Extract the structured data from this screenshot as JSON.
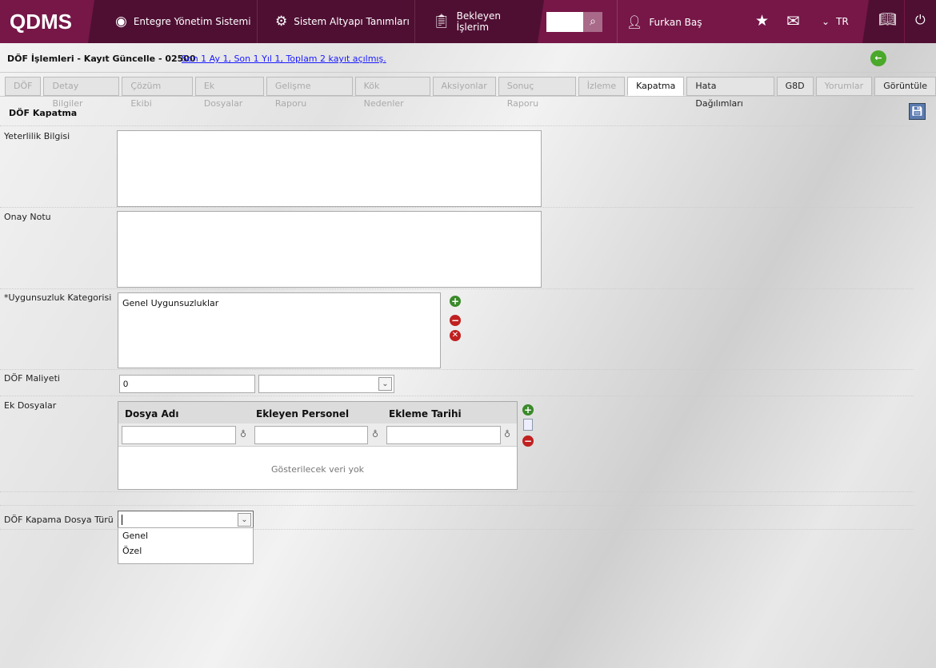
{
  "header": {
    "logo": "QDMS",
    "nav": [
      {
        "label": "Entegre Yönetim Sistemi",
        "icon": "q-icon"
      },
      {
        "label": "Sistem Altyapı Tanımları",
        "icon": "gear-icon"
      },
      {
        "label": "Bekleyen İşlerim",
        "icon": "clipboard-icon"
      }
    ],
    "user": "Furkan Baş",
    "lang": "TR"
  },
  "subheader": {
    "title": "DÖF İşlemleri - Kayıt Güncelle - 02500",
    "stats": "Son 1 Ay 1, Son 1 Yıl 1, Toplam 2 kayıt açılmış."
  },
  "tabs": [
    {
      "label": "DÖF"
    },
    {
      "label": "Detay Bilgiler"
    },
    {
      "label": "Çözüm Ekibi"
    },
    {
      "label": "Ek Dosyalar"
    },
    {
      "label": "Gelişme Raporu"
    },
    {
      "label": "Kök Nedenler"
    },
    {
      "label": "Aksiyonlar"
    },
    {
      "label": "Sonuç Raporu"
    },
    {
      "label": "İzleme"
    },
    {
      "label": "Kapatma"
    },
    {
      "label": "Hata Dağılımları"
    },
    {
      "label": "G8D"
    },
    {
      "label": "Yorumlar"
    },
    {
      "label": "Görüntüle"
    }
  ],
  "panel": {
    "title": "DÖF Kapatma",
    "yeterlilik_label": "Yeterlilik Bilgisi",
    "onay_label": "Onay Notu",
    "kategori_label": "*Uygunsuzluk Kategorisi",
    "kategori_value": "Genel Uygunsuzluklar",
    "maliyet_label": "DÖF Maliyeti",
    "maliyet_value": "0",
    "ek_label": "Ek Dosyalar",
    "columns": [
      "Dosya Adı",
      "Ekleyen Personel",
      "Ekleme Tarihi"
    ],
    "empty": "Gösterilecek veri yok",
    "tur_label": "DÖF Kapama Dosya Türü",
    "tur_options": [
      "Genel",
      "Özel"
    ]
  }
}
